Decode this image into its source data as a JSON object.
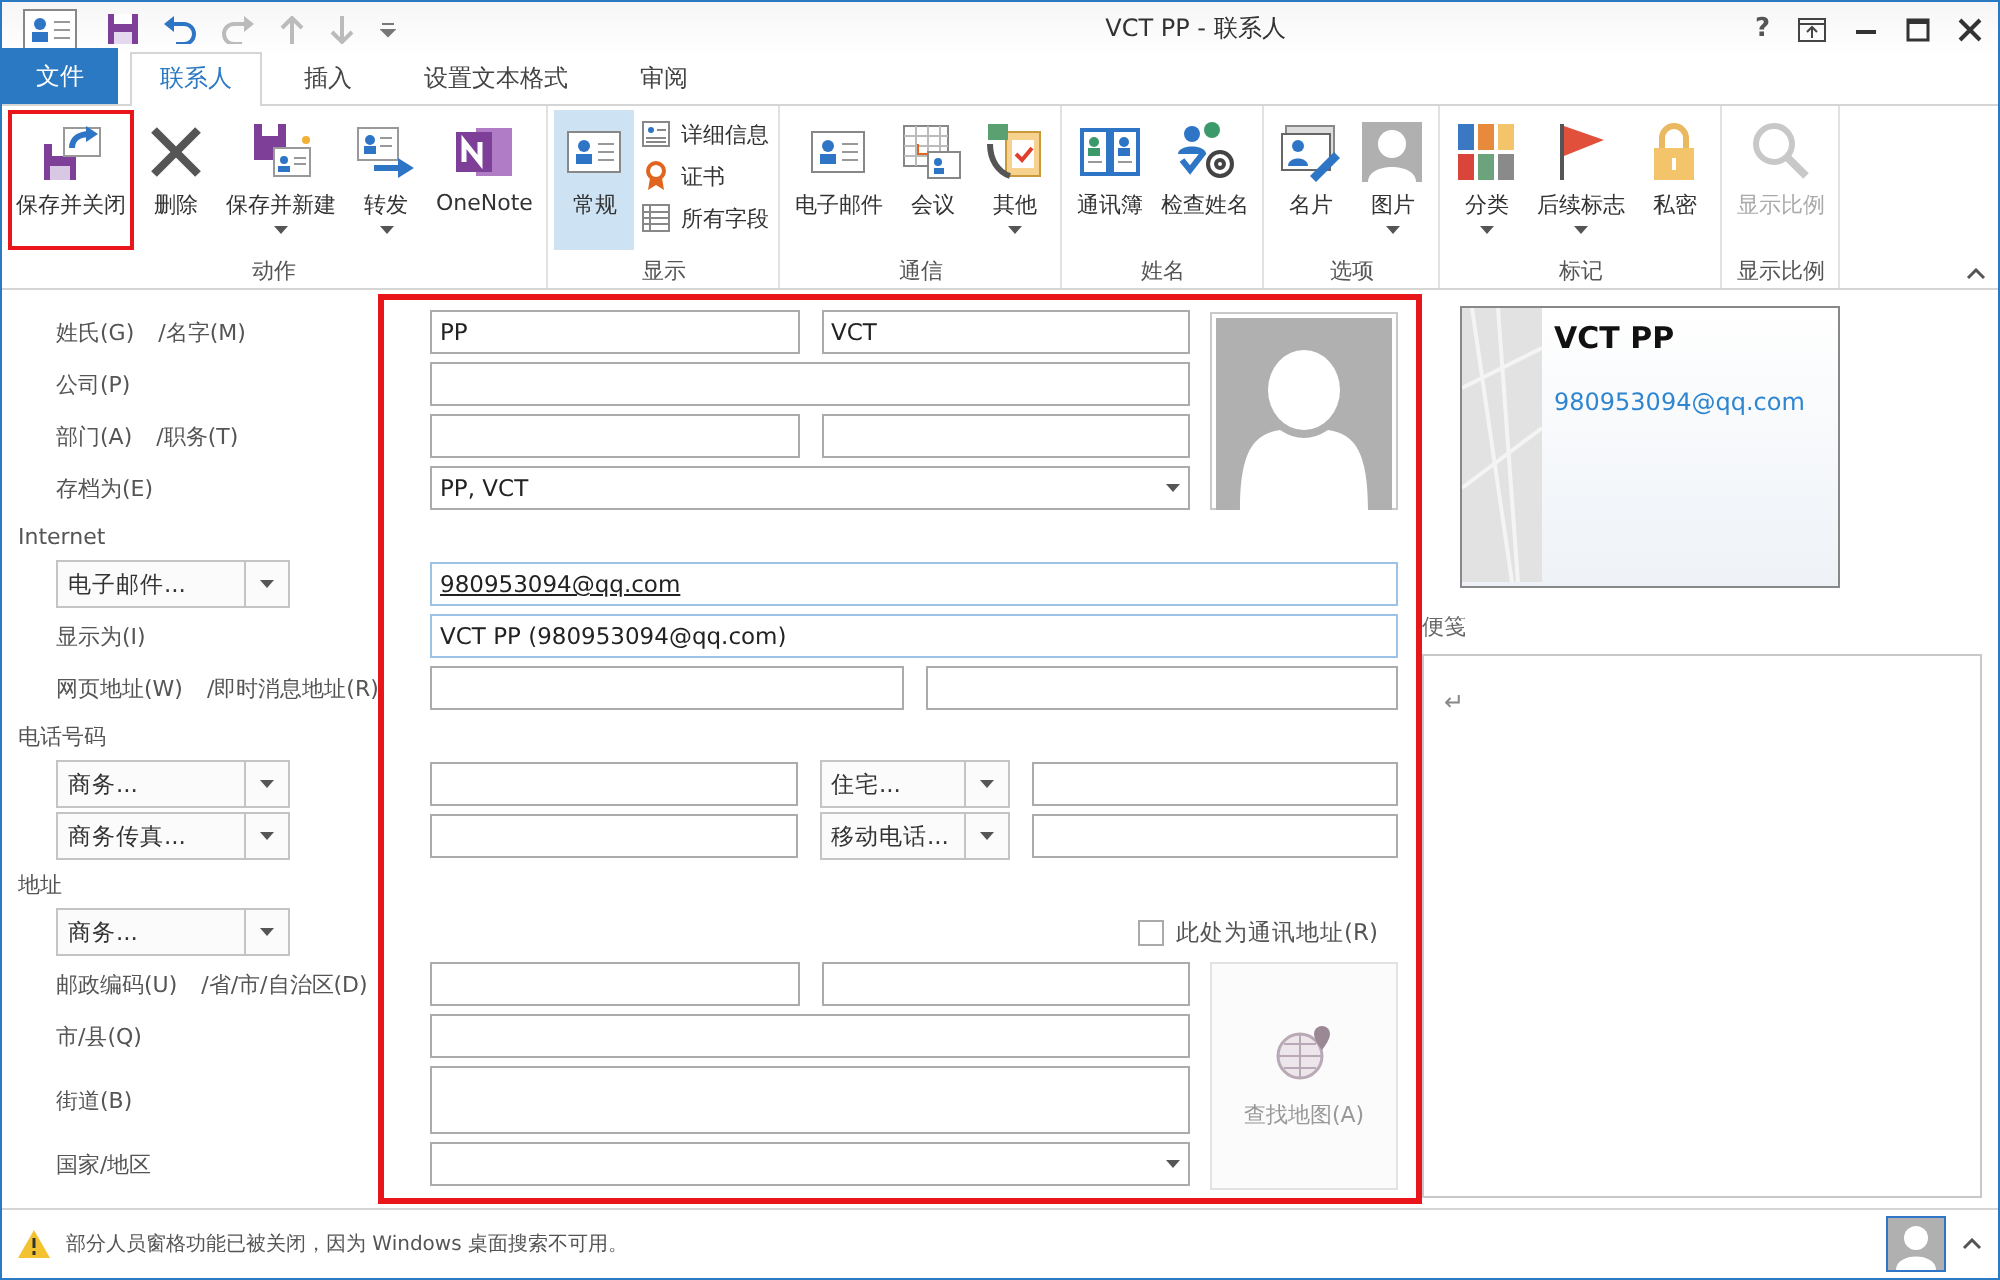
{
  "window": {
    "title": "VCT PP - 联系人",
    "help": "?"
  },
  "tabs": [
    {
      "label": "文件",
      "kind": "file",
      "selected": false
    },
    {
      "label": "联系人",
      "kind": "tab",
      "selected": true
    },
    {
      "label": "插入",
      "kind": "tab",
      "selected": false
    },
    {
      "label": "设置文本格式",
      "kind": "tab",
      "selected": false
    },
    {
      "label": "审阅",
      "kind": "tab",
      "selected": false
    }
  ],
  "ribbon": {
    "groups": [
      {
        "label": "动作",
        "buttons": [
          {
            "label": "保存并关闭",
            "kind": "large",
            "dropdown": false,
            "selected": false,
            "disabled": false,
            "highlighted": true
          },
          {
            "label": "删除",
            "kind": "large",
            "dropdown": false,
            "selected": false,
            "disabled": false,
            "highlighted": false
          },
          {
            "label": "保存并新建",
            "kind": "large",
            "dropdown": true,
            "selected": false,
            "disabled": false,
            "highlighted": false
          },
          {
            "label": "转发",
            "kind": "large",
            "dropdown": true,
            "selected": false,
            "disabled": false,
            "highlighted": false
          },
          {
            "label": "OneNote",
            "kind": "large",
            "dropdown": false,
            "selected": false,
            "disabled": false,
            "highlighted": false
          }
        ]
      },
      {
        "label": "显示",
        "buttons": [
          {
            "label": "常规",
            "kind": "large",
            "dropdown": false,
            "selected": true,
            "disabled": false,
            "highlighted": false
          },
          {
            "label": "详细信息",
            "kind": "small",
            "dropdown": false,
            "selected": false,
            "disabled": false,
            "highlighted": false
          },
          {
            "label": "证书",
            "kind": "small",
            "dropdown": false,
            "selected": false,
            "disabled": false,
            "highlighted": false
          },
          {
            "label": "所有字段",
            "kind": "small",
            "dropdown": false,
            "selected": false,
            "disabled": false,
            "highlighted": false
          }
        ]
      },
      {
        "label": "通信",
        "buttons": [
          {
            "label": "电子邮件",
            "kind": "large",
            "dropdown": false,
            "selected": false,
            "disabled": false,
            "highlighted": false
          },
          {
            "label": "会议",
            "kind": "large",
            "dropdown": false,
            "selected": false,
            "disabled": false,
            "highlighted": false
          },
          {
            "label": "其他",
            "kind": "large",
            "dropdown": true,
            "selected": false,
            "disabled": false,
            "highlighted": false
          }
        ]
      },
      {
        "label": "姓名",
        "buttons": [
          {
            "label": "通讯簿",
            "kind": "large",
            "dropdown": false,
            "selected": false,
            "disabled": false,
            "highlighted": false
          },
          {
            "label": "检查姓名",
            "kind": "large",
            "dropdown": false,
            "selected": false,
            "disabled": false,
            "highlighted": false
          }
        ]
      },
      {
        "label": "选项",
        "buttons": [
          {
            "label": "名片",
            "kind": "large",
            "dropdown": false,
            "selected": false,
            "disabled": false,
            "highlighted": false
          },
          {
            "label": "图片",
            "kind": "large",
            "dropdown": true,
            "selected": false,
            "disabled": false,
            "highlighted": false
          }
        ]
      },
      {
        "label": "标记",
        "buttons": [
          {
            "label": "分类",
            "kind": "large",
            "dropdown": true,
            "selected": false,
            "disabled": false,
            "highlighted": false
          },
          {
            "label": "后续标志",
            "kind": "large",
            "dropdown": true,
            "selected": false,
            "disabled": false,
            "highlighted": false
          },
          {
            "label": "私密",
            "kind": "large",
            "dropdown": false,
            "selected": false,
            "disabled": false,
            "highlighted": false
          }
        ]
      },
      {
        "label": "显示比例",
        "buttons": [
          {
            "label": "显示比例",
            "kind": "large",
            "dropdown": false,
            "selected": false,
            "disabled": true,
            "highlighted": false
          }
        ]
      }
    ]
  },
  "form": {
    "highlighted": true,
    "blocks": [
      {
        "kind": "with-photo",
        "rows": [
          {
            "kind": "row",
            "labels": [
              "姓氏(G)",
              "/名字(M)"
            ],
            "inputs": [
              {
                "kind": "text",
                "value": "PP"
              },
              {
                "kind": "text",
                "value": "VCT"
              }
            ]
          },
          {
            "kind": "row",
            "labels": [
              "公司(P)"
            ],
            "inputs": [
              {
                "kind": "text"
              }
            ]
          },
          {
            "kind": "row",
            "labels": [
              "部门(A)",
              "/职务(T)"
            ],
            "inputs": [
              {
                "kind": "text"
              },
              {
                "kind": "text"
              }
            ]
          },
          {
            "kind": "row",
            "labels": [
              "存档为(E)"
            ],
            "inputs": [
              {
                "kind": "combo",
                "value": "PP, VCT"
              }
            ]
          }
        ]
      },
      {
        "kind": "plain",
        "rows": [
          {
            "kind": "section",
            "label": "Internet"
          },
          {
            "kind": "row",
            "selector": "电子邮件...",
            "inputs": [
              {
                "kind": "email",
                "value": "980953094@qq.com"
              }
            ]
          },
          {
            "kind": "row",
            "labels": [
              "显示为(I)"
            ],
            "inputs": [
              {
                "kind": "linked",
                "value": "VCT PP (980953094@qq.com)"
              }
            ]
          },
          {
            "kind": "row",
            "labels": [
              "网页地址(W)",
              "/即时消息地址(R)"
            ],
            "inputs": [
              {
                "kind": "text"
              },
              {
                "kind": "text"
              }
            ]
          },
          {
            "kind": "section",
            "label": "电话号码"
          },
          {
            "kind": "row",
            "selector": "商务...",
            "inputs": [
              {
                "kind": "text"
              },
              {
                "kind": "selector",
                "value": "住宅..."
              },
              {
                "kind": "text"
              }
            ]
          },
          {
            "kind": "row",
            "selector": "商务传真...",
            "inputs": [
              {
                "kind": "text"
              },
              {
                "kind": "selector",
                "value": "移动电话..."
              },
              {
                "kind": "text"
              }
            ]
          },
          {
            "kind": "section",
            "label": "地址"
          },
          {
            "kind": "row",
            "selector": "商务...",
            "checkbox": {
              "label": "此处为通讯地址(R)",
              "checked": false
            }
          }
        ]
      },
      {
        "kind": "with-map",
        "map_button": "查找地图(A)",
        "rows": [
          {
            "kind": "row",
            "labels": [
              "邮政编码(U)",
              "/省/市/自治区(D)"
            ],
            "inputs": [
              {
                "kind": "text"
              },
              {
                "kind": "text"
              }
            ]
          },
          {
            "kind": "row",
            "labels": [
              "市/县(Q)"
            ],
            "inputs": [
              {
                "kind": "text"
              }
            ]
          },
          {
            "kind": "row",
            "labels": [
              "街道(B)"
            ],
            "inputs": [
              {
                "kind": "textarea"
              }
            ]
          },
          {
            "kind": "row",
            "labels": [
              "国家/地区"
            ],
            "inputs": [
              {
                "kind": "combo"
              }
            ]
          }
        ]
      }
    ]
  },
  "card": {
    "name": "VCT PP",
    "email": "980953094@qq.com"
  },
  "notes": {
    "label": "便笺",
    "content": "↵"
  },
  "status_bar": {
    "message": "部分人员窗格功能已被关闭，因为 Windows 桌面搜索不可用。"
  }
}
